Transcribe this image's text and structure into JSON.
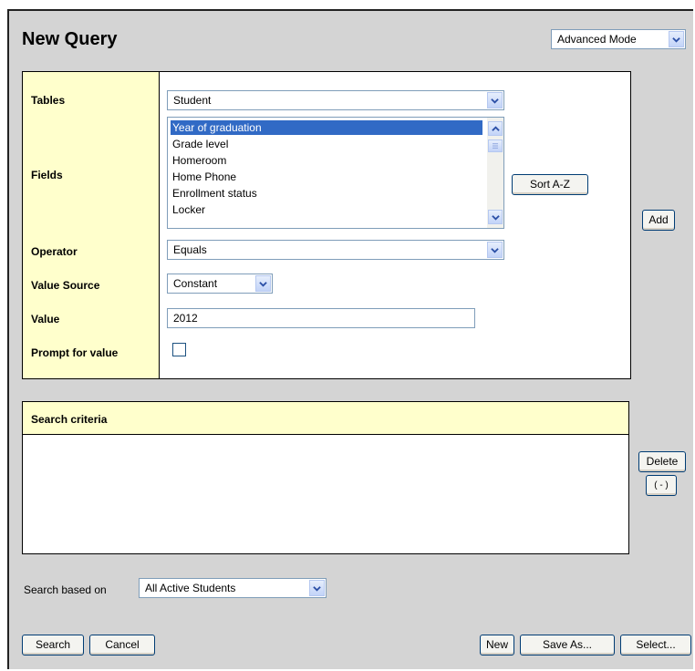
{
  "header": {
    "title": "New Query",
    "mode_select": "Advanced Mode"
  },
  "form": {
    "tables": {
      "label": "Tables",
      "value": "Student"
    },
    "fields": {
      "label": "Fields",
      "options": [
        "Year of graduation",
        "Grade level",
        "Homeroom",
        "Home Phone",
        "Enrollment status",
        "Locker"
      ],
      "selected": "Year of graduation",
      "sort_label": "Sort A-Z"
    },
    "operator": {
      "label": "Operator",
      "value": "Equals"
    },
    "value_source": {
      "label": "Value Source",
      "value": "Constant"
    },
    "value": {
      "label": "Value",
      "value": "2012"
    },
    "prompt": {
      "label": "Prompt for value",
      "checked": false
    }
  },
  "side_buttons": {
    "add": "Add",
    "delete": "Delete",
    "minus": "( - )"
  },
  "criteria": {
    "header": "Search criteria"
  },
  "search_based_on": {
    "label": "Search based on",
    "value": "All Active Students"
  },
  "footer": {
    "search": "Search",
    "cancel": "Cancel",
    "new": "New",
    "save_as": "Save As...",
    "select": "Select..."
  },
  "colors": {
    "label_bg": "#ffffcc",
    "selection": "#316ac5",
    "page_bg": "#d4d4d4"
  }
}
